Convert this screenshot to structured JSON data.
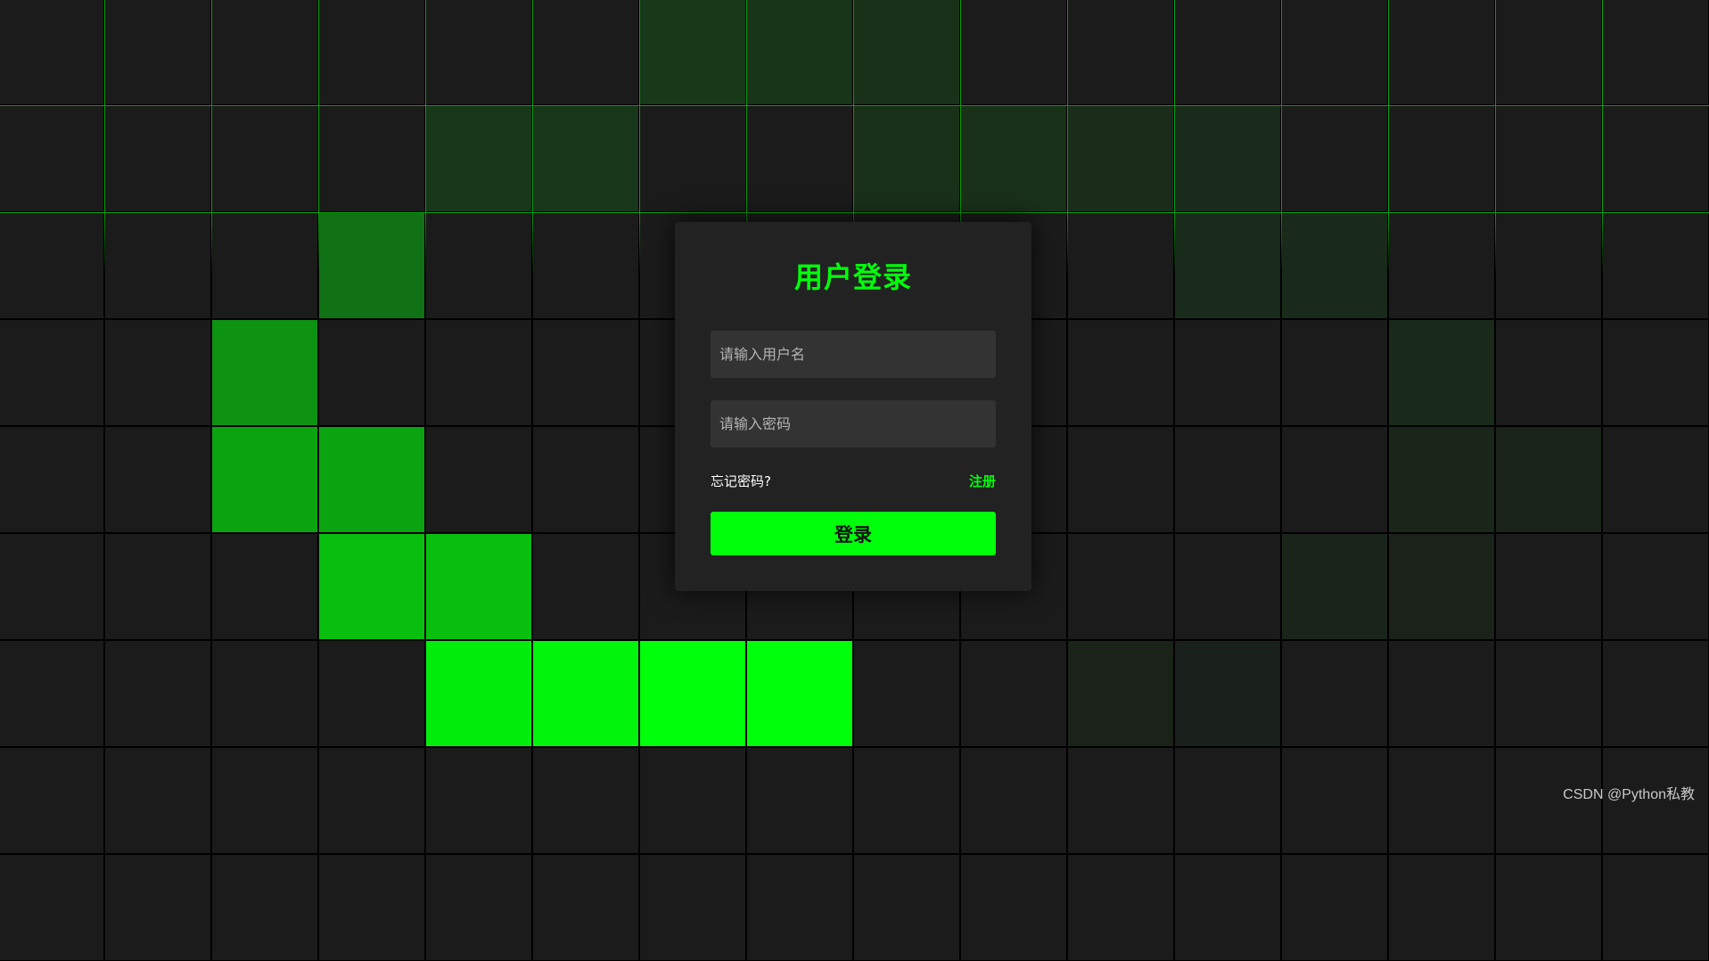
{
  "login": {
    "title": "用户登录",
    "username_placeholder": "请输入用户名",
    "password_placeholder": "请输入密码",
    "forgot_password": "忘记密码?",
    "register": "注册",
    "login_button": "登录"
  },
  "watermark": "CSDN @Python私教",
  "colors": {
    "accent": "#00ff0a",
    "background": "#1b1b1b",
    "card": "#222222",
    "input": "#333333"
  },
  "grid": {
    "columns": 16,
    "rows": 8,
    "highlighted_cells": [
      {
        "col": 3,
        "row": 2,
        "intensity": 0.38
      },
      {
        "col": 2,
        "row": 3,
        "intensity": 0.52
      },
      {
        "col": 2,
        "row": 4,
        "intensity": 0.6
      },
      {
        "col": 3,
        "row": 4,
        "intensity": 0.6
      },
      {
        "col": 3,
        "row": 5,
        "intensity": 0.72
      },
      {
        "col": 4,
        "row": 5,
        "intensity": 0.72
      },
      {
        "col": 4,
        "row": 6,
        "intensity": 0.92
      },
      {
        "col": 5,
        "row": 6,
        "intensity": 0.95
      },
      {
        "col": 6,
        "row": 6,
        "intensity": 1.0
      },
      {
        "col": 7,
        "row": 6,
        "intensity": 1.0
      },
      {
        "col": 6,
        "row": 0,
        "intensity": 0.13
      },
      {
        "col": 7,
        "row": 0,
        "intensity": 0.11
      },
      {
        "col": 8,
        "row": 0,
        "intensity": 0.09
      },
      {
        "col": 4,
        "row": 1,
        "intensity": 0.12
      },
      {
        "col": 5,
        "row": 1,
        "intensity": 0.12
      },
      {
        "col": 8,
        "row": 1,
        "intensity": 0.09
      },
      {
        "col": 9,
        "row": 1,
        "intensity": 0.09
      },
      {
        "col": 10,
        "row": 1,
        "intensity": 0.08
      },
      {
        "col": 11,
        "row": 1,
        "intensity": 0.07
      },
      {
        "col": 11,
        "row": 2,
        "intensity": 0.07
      },
      {
        "col": 12,
        "row": 2,
        "intensity": 0.06
      },
      {
        "col": 13,
        "row": 3,
        "intensity": 0.06
      },
      {
        "col": 13,
        "row": 4,
        "intensity": 0.05
      },
      {
        "col": 14,
        "row": 4,
        "intensity": 0.04
      },
      {
        "col": 12,
        "row": 5,
        "intensity": 0.04
      },
      {
        "col": 13,
        "row": 5,
        "intensity": 0.03
      },
      {
        "col": 10,
        "row": 6,
        "intensity": 0.03
      },
      {
        "col": 11,
        "row": 6,
        "intensity": 0.02
      }
    ],
    "lit_grid_rows": [
      0,
      1
    ]
  }
}
